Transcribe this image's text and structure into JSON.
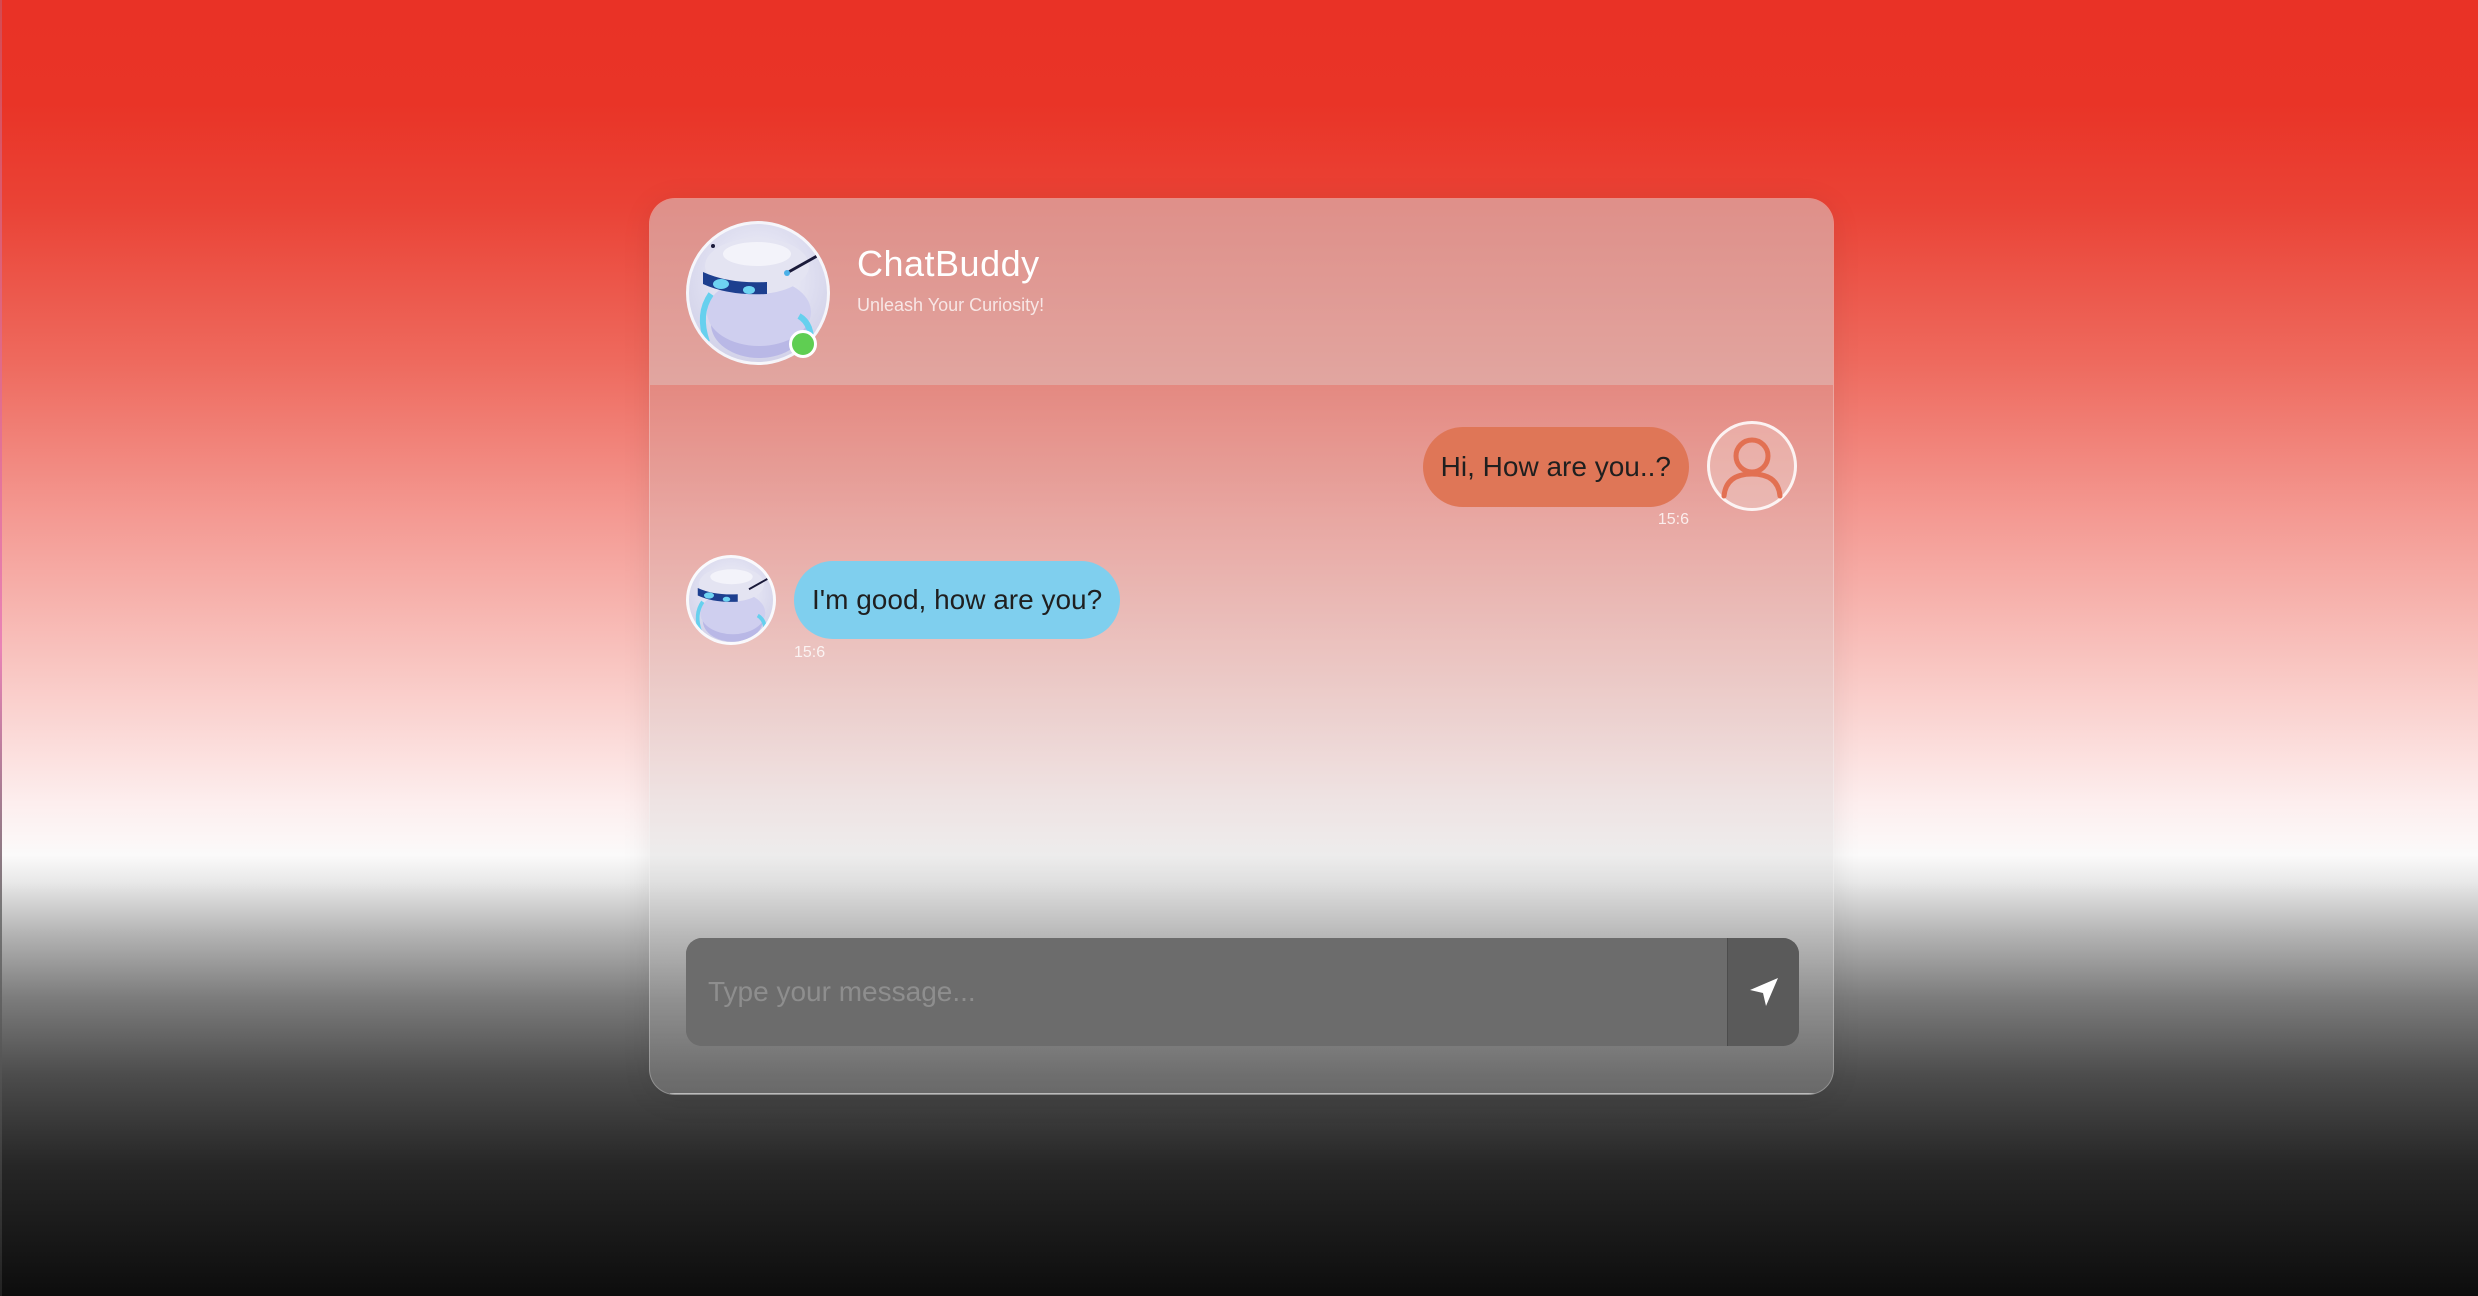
{
  "app": {
    "title": "ChatBuddy",
    "subtitle": "Unleash Your Curiosity!",
    "status": "online"
  },
  "messages": [
    {
      "sender": "user",
      "text": "Hi, How are you..?",
      "time": "15:6",
      "avatar_icon": "user-icon"
    },
    {
      "sender": "bot",
      "text": "I'm good, how are you?",
      "time": "15:6",
      "avatar_icon": "robot-icon"
    }
  ],
  "composer": {
    "placeholder": "Type your message...",
    "value": "",
    "send_icon": "paper-plane-icon"
  },
  "colors": {
    "user_bubble": "#df7657",
    "bot_bubble": "#7fcfee",
    "online_indicator": "#5fce52",
    "background_top": "#e93226",
    "background_bottom": "#0d0d0d"
  }
}
